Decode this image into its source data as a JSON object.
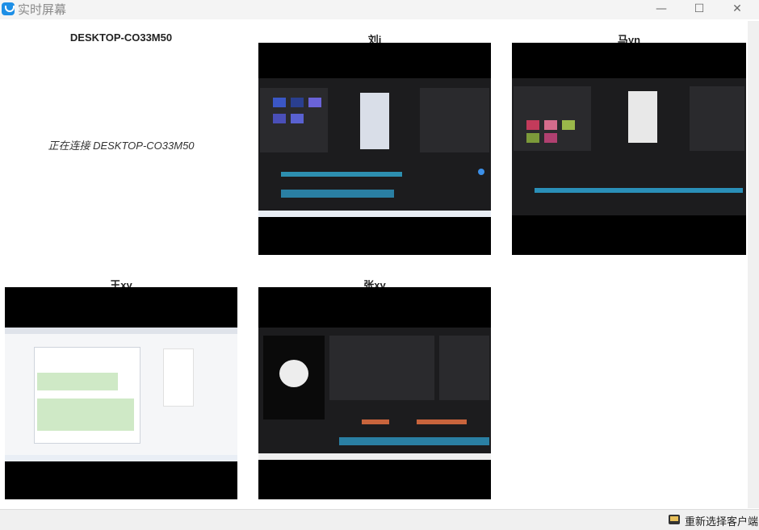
{
  "window": {
    "title": "实时屏幕",
    "minimize_glyph": "—",
    "maximize_glyph": "☐",
    "close_glyph": "✕"
  },
  "tiles": [
    {
      "name": "DESKTOP-CO33M50",
      "status": "正在连接 DESKTOP-CO33M50"
    },
    {
      "name": "刘j"
    },
    {
      "name": "马yn"
    },
    {
      "name": "王xy"
    },
    {
      "name": "张xy"
    }
  ],
  "footer": {
    "reselect_label": "重新选择客户端"
  },
  "icons": [
    "app-logo-icon",
    "client-select-icon"
  ],
  "colors": {
    "accent": "#1e8fe6",
    "screen_bg": "#000000"
  }
}
